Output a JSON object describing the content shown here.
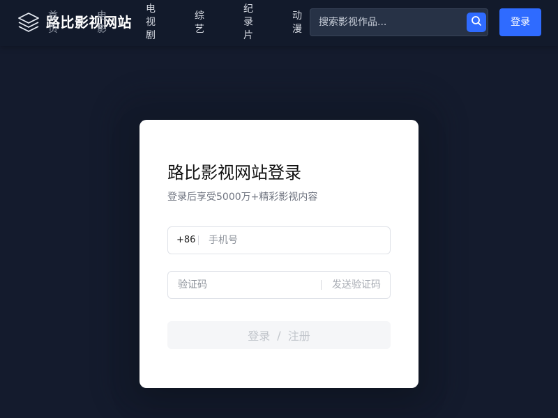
{
  "header": {
    "brand": "路比影视网站",
    "logo_icon": "layers-icon",
    "nav": [
      {
        "label": "首页"
      },
      {
        "label": "电影"
      },
      {
        "label": "电视剧"
      },
      {
        "label": "综艺"
      },
      {
        "label": "纪录片"
      },
      {
        "label": "动漫"
      }
    ],
    "search": {
      "placeholder": "搜索影视作品...",
      "icon": "search-icon"
    },
    "login_label": "登录"
  },
  "login_card": {
    "title": "路比影视网站登录",
    "subtitle": "登录后享受5000万+精彩影视内容",
    "phone_prefix": "+86",
    "phone_placeholder": "手机号",
    "code_placeholder": "验证码",
    "send_code_label": "发送验证码",
    "submit_login": "登录",
    "submit_separator": "/",
    "submit_register": "注册"
  },
  "colors": {
    "background": "#141b2d",
    "header": "#121a2b",
    "accent": "#2f6bff",
    "card": "#ffffff"
  }
}
